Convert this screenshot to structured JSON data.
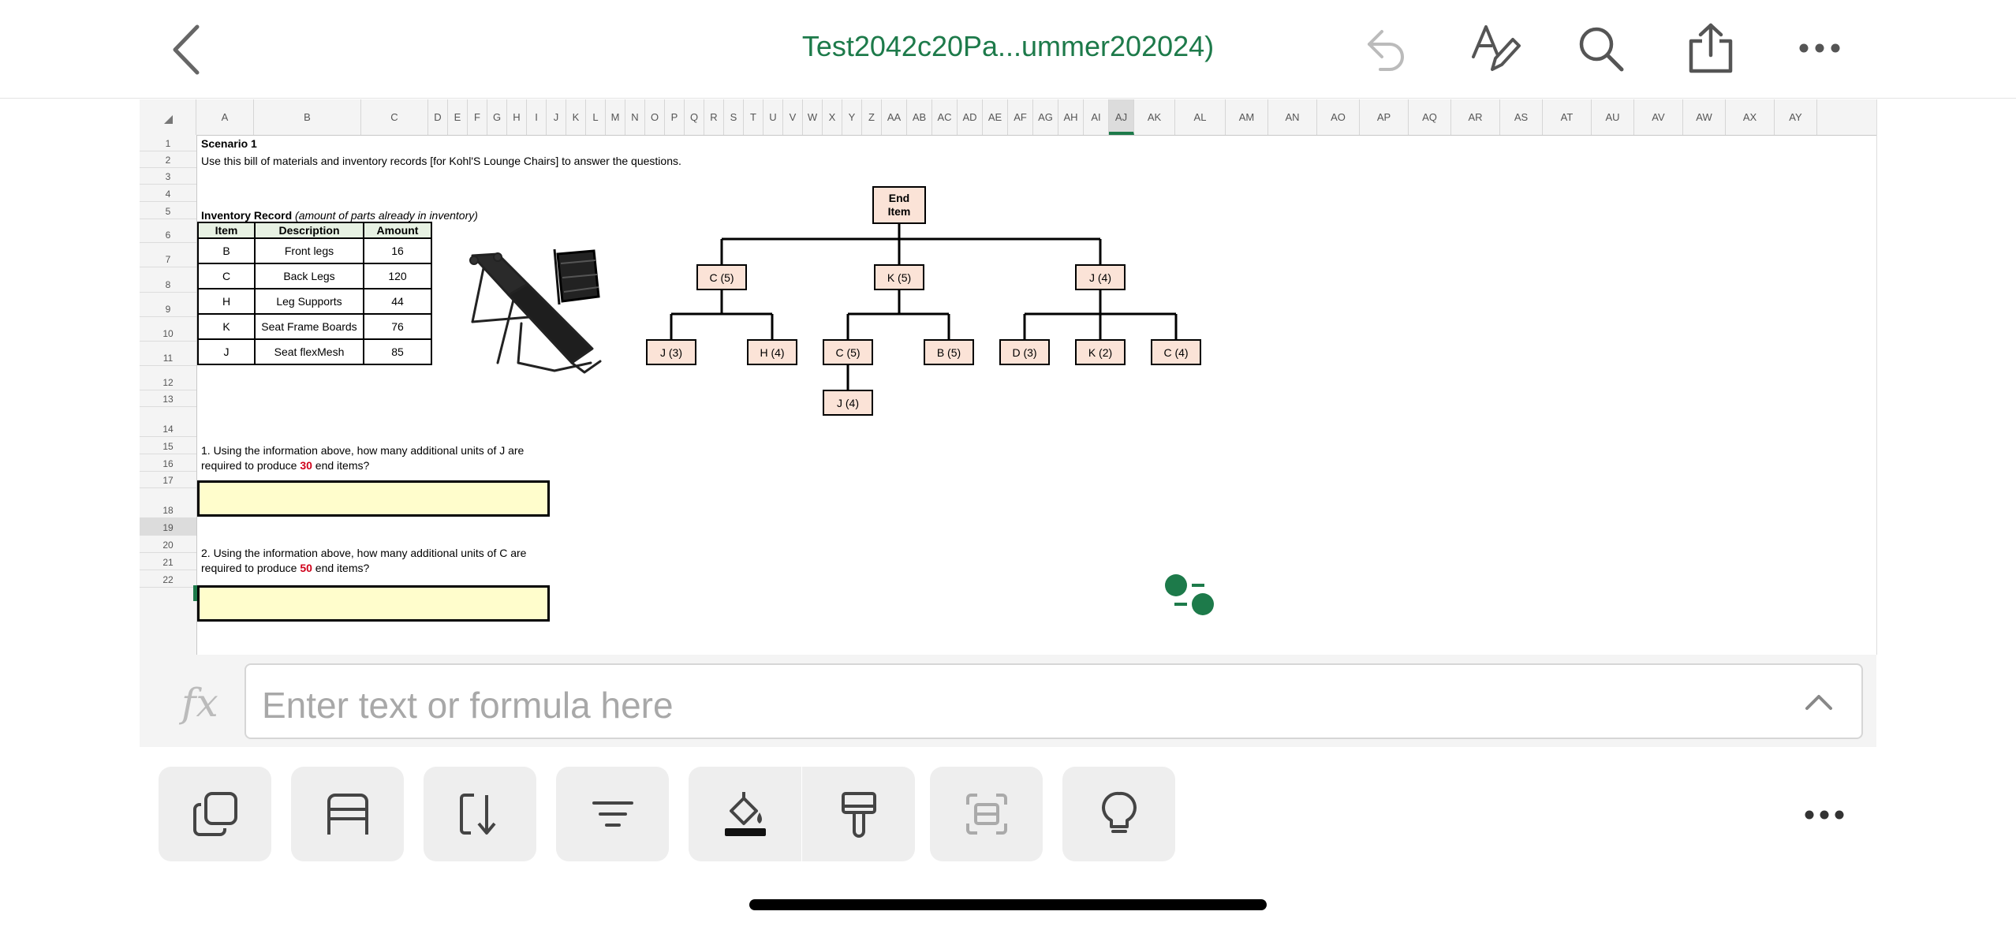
{
  "topbar": {
    "title": "Test2042c20Pa...ummer202024)",
    "icons": [
      "back-chevron-icon",
      "undo-icon",
      "text-format-pen-icon",
      "search-icon",
      "share-icon",
      "more-icon"
    ]
  },
  "sheet": {
    "columns": [
      "A",
      "B",
      "C",
      "D",
      "E",
      "F",
      "G",
      "H",
      "I",
      "J",
      "K",
      "L",
      "M",
      "N",
      "O",
      "P",
      "Q",
      "R",
      "S",
      "T",
      "U",
      "V",
      "W",
      "X",
      "Y",
      "Z",
      "AA",
      "AB",
      "AC",
      "AD",
      "AE",
      "AF",
      "AG",
      "AH",
      "AI",
      "AJ",
      "AK",
      "AL",
      "AM",
      "AN",
      "AO",
      "AP",
      "AQ",
      "AR",
      "AS",
      "AT",
      "AU",
      "AV",
      "AW",
      "AX",
      "AY"
    ],
    "selected_column": "AJ",
    "rows": [
      "1",
      "2",
      "3",
      "4",
      "5",
      "6",
      "7",
      "8",
      "9",
      "10",
      "11",
      "12",
      "13",
      "14",
      "15",
      "16",
      "17",
      "18",
      "19",
      "20",
      "21",
      "22"
    ],
    "selected_row": "19",
    "scenario_title": "Scenario 1",
    "instructions": "Use this bill of materials and inventory records  [for Kohl'S Lounge Chairs] to answer the questions.",
    "inventory_label_bold": "Inventory Record",
    "inventory_label_italic": " (amount of parts already in inventory)",
    "inventory": {
      "headers": [
        "Item",
        "Description",
        "Amount"
      ],
      "rows": [
        [
          "B",
          "Front legs",
          "16"
        ],
        [
          "C",
          "Back Legs",
          "120"
        ],
        [
          "H",
          "Leg Supports",
          "44"
        ],
        [
          "K",
          "Seat Frame Boards",
          "76"
        ],
        [
          "J",
          "Seat flexMesh",
          "85"
        ]
      ]
    },
    "bom_tree": {
      "root": "End Item",
      "root_line1": "End",
      "root_line2": "Item",
      "level1": [
        "C (5)",
        "K (5)",
        "J (4)"
      ],
      "level2": [
        "J (3)",
        "H (4)",
        "C (5)",
        "B (5)",
        "D (3)",
        "K (2)",
        "C (4)"
      ],
      "level3": [
        "J (4)"
      ]
    },
    "q1_line1": "1. Using the information above, how many additional units of J are",
    "q1_pre": "required to produce ",
    "q1_num": "30",
    "q1_post": " end items?",
    "q2_line1": "2. Using the information above, how many additional units of C are",
    "q2_pre": "required to produce ",
    "q2_num": "50",
    "q2_post": " end items?"
  },
  "formula_bar": {
    "fx_label": "fx",
    "placeholder": "Enter text or formula here"
  },
  "bottom_toolbar": {
    "buttons": [
      "copy-icon",
      "freeze-panes-icon",
      "sort-icon",
      "filter-icon",
      "fill-color-icon",
      "format-painter-icon",
      "select-region-icon",
      "ideas-lightbulb-icon",
      "more-icon"
    ]
  },
  "colors": {
    "accent": "#1d7a4a",
    "tree_node_fill": "#fbe3d7",
    "answer_fill": "#fffdcc",
    "table_header_fill": "#e7f1e3",
    "highlight_number": "#d0021b"
  }
}
